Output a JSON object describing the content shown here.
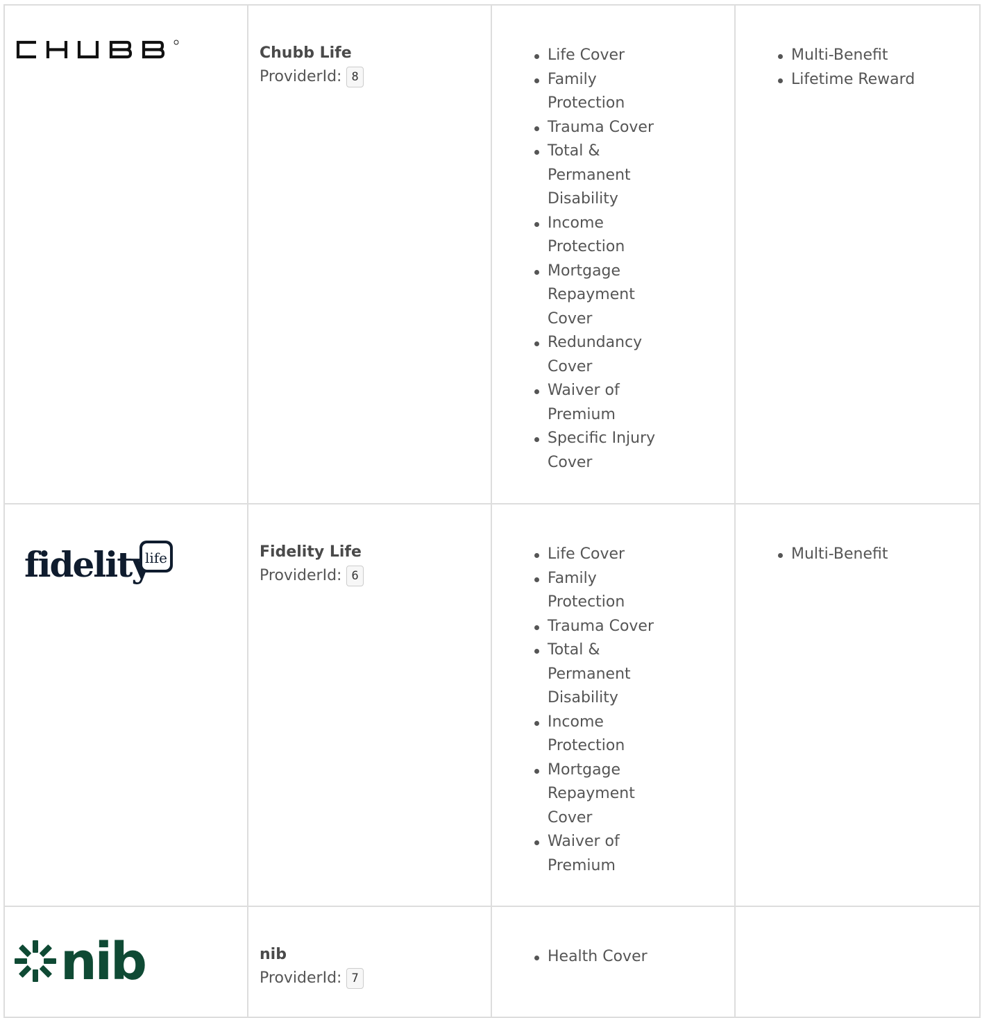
{
  "providers": [
    {
      "logo_text": "CHUBB",
      "logo_icon": "chubb-logo",
      "name": "Chubb Life",
      "id_label": "ProviderId:",
      "id_value": "8",
      "benefits": [
        "Life Cover",
        "Family Protection",
        "Trauma Cover",
        "Total & Permanent Disability",
        "Income Protection",
        "Mortgage Repayment Cover",
        "Redundancy Cover",
        "Waiver of Premium",
        "Specific Injury Cover"
      ],
      "products": [
        "Multi-Benefit",
        "Lifetime Reward"
      ]
    },
    {
      "logo_text": "fidelity",
      "logo_badge_text": "life",
      "logo_icon": "fidelity-life-logo",
      "name": "Fidelity Life",
      "id_label": "ProviderId:",
      "id_value": "6",
      "benefits": [
        "Life Cover",
        "Family Protection",
        "Trauma Cover",
        "Total & Permanent Disability",
        "Income Protection",
        "Mortgage Repayment Cover",
        "Waiver of Premium"
      ],
      "products": [
        "Multi-Benefit"
      ]
    },
    {
      "logo_text": "nib",
      "logo_icon": "nib-logo",
      "name": "nib",
      "id_label": "ProviderId:",
      "id_value": "7",
      "benefits": [
        "Health Cover"
      ],
      "products": []
    }
  ],
  "colors": {
    "chubb_logo": "#111111",
    "fidelity_logo": "#0f1c2e",
    "nib_logo": "#0f4a34",
    "border": "#dddddd",
    "text": "#555555"
  }
}
